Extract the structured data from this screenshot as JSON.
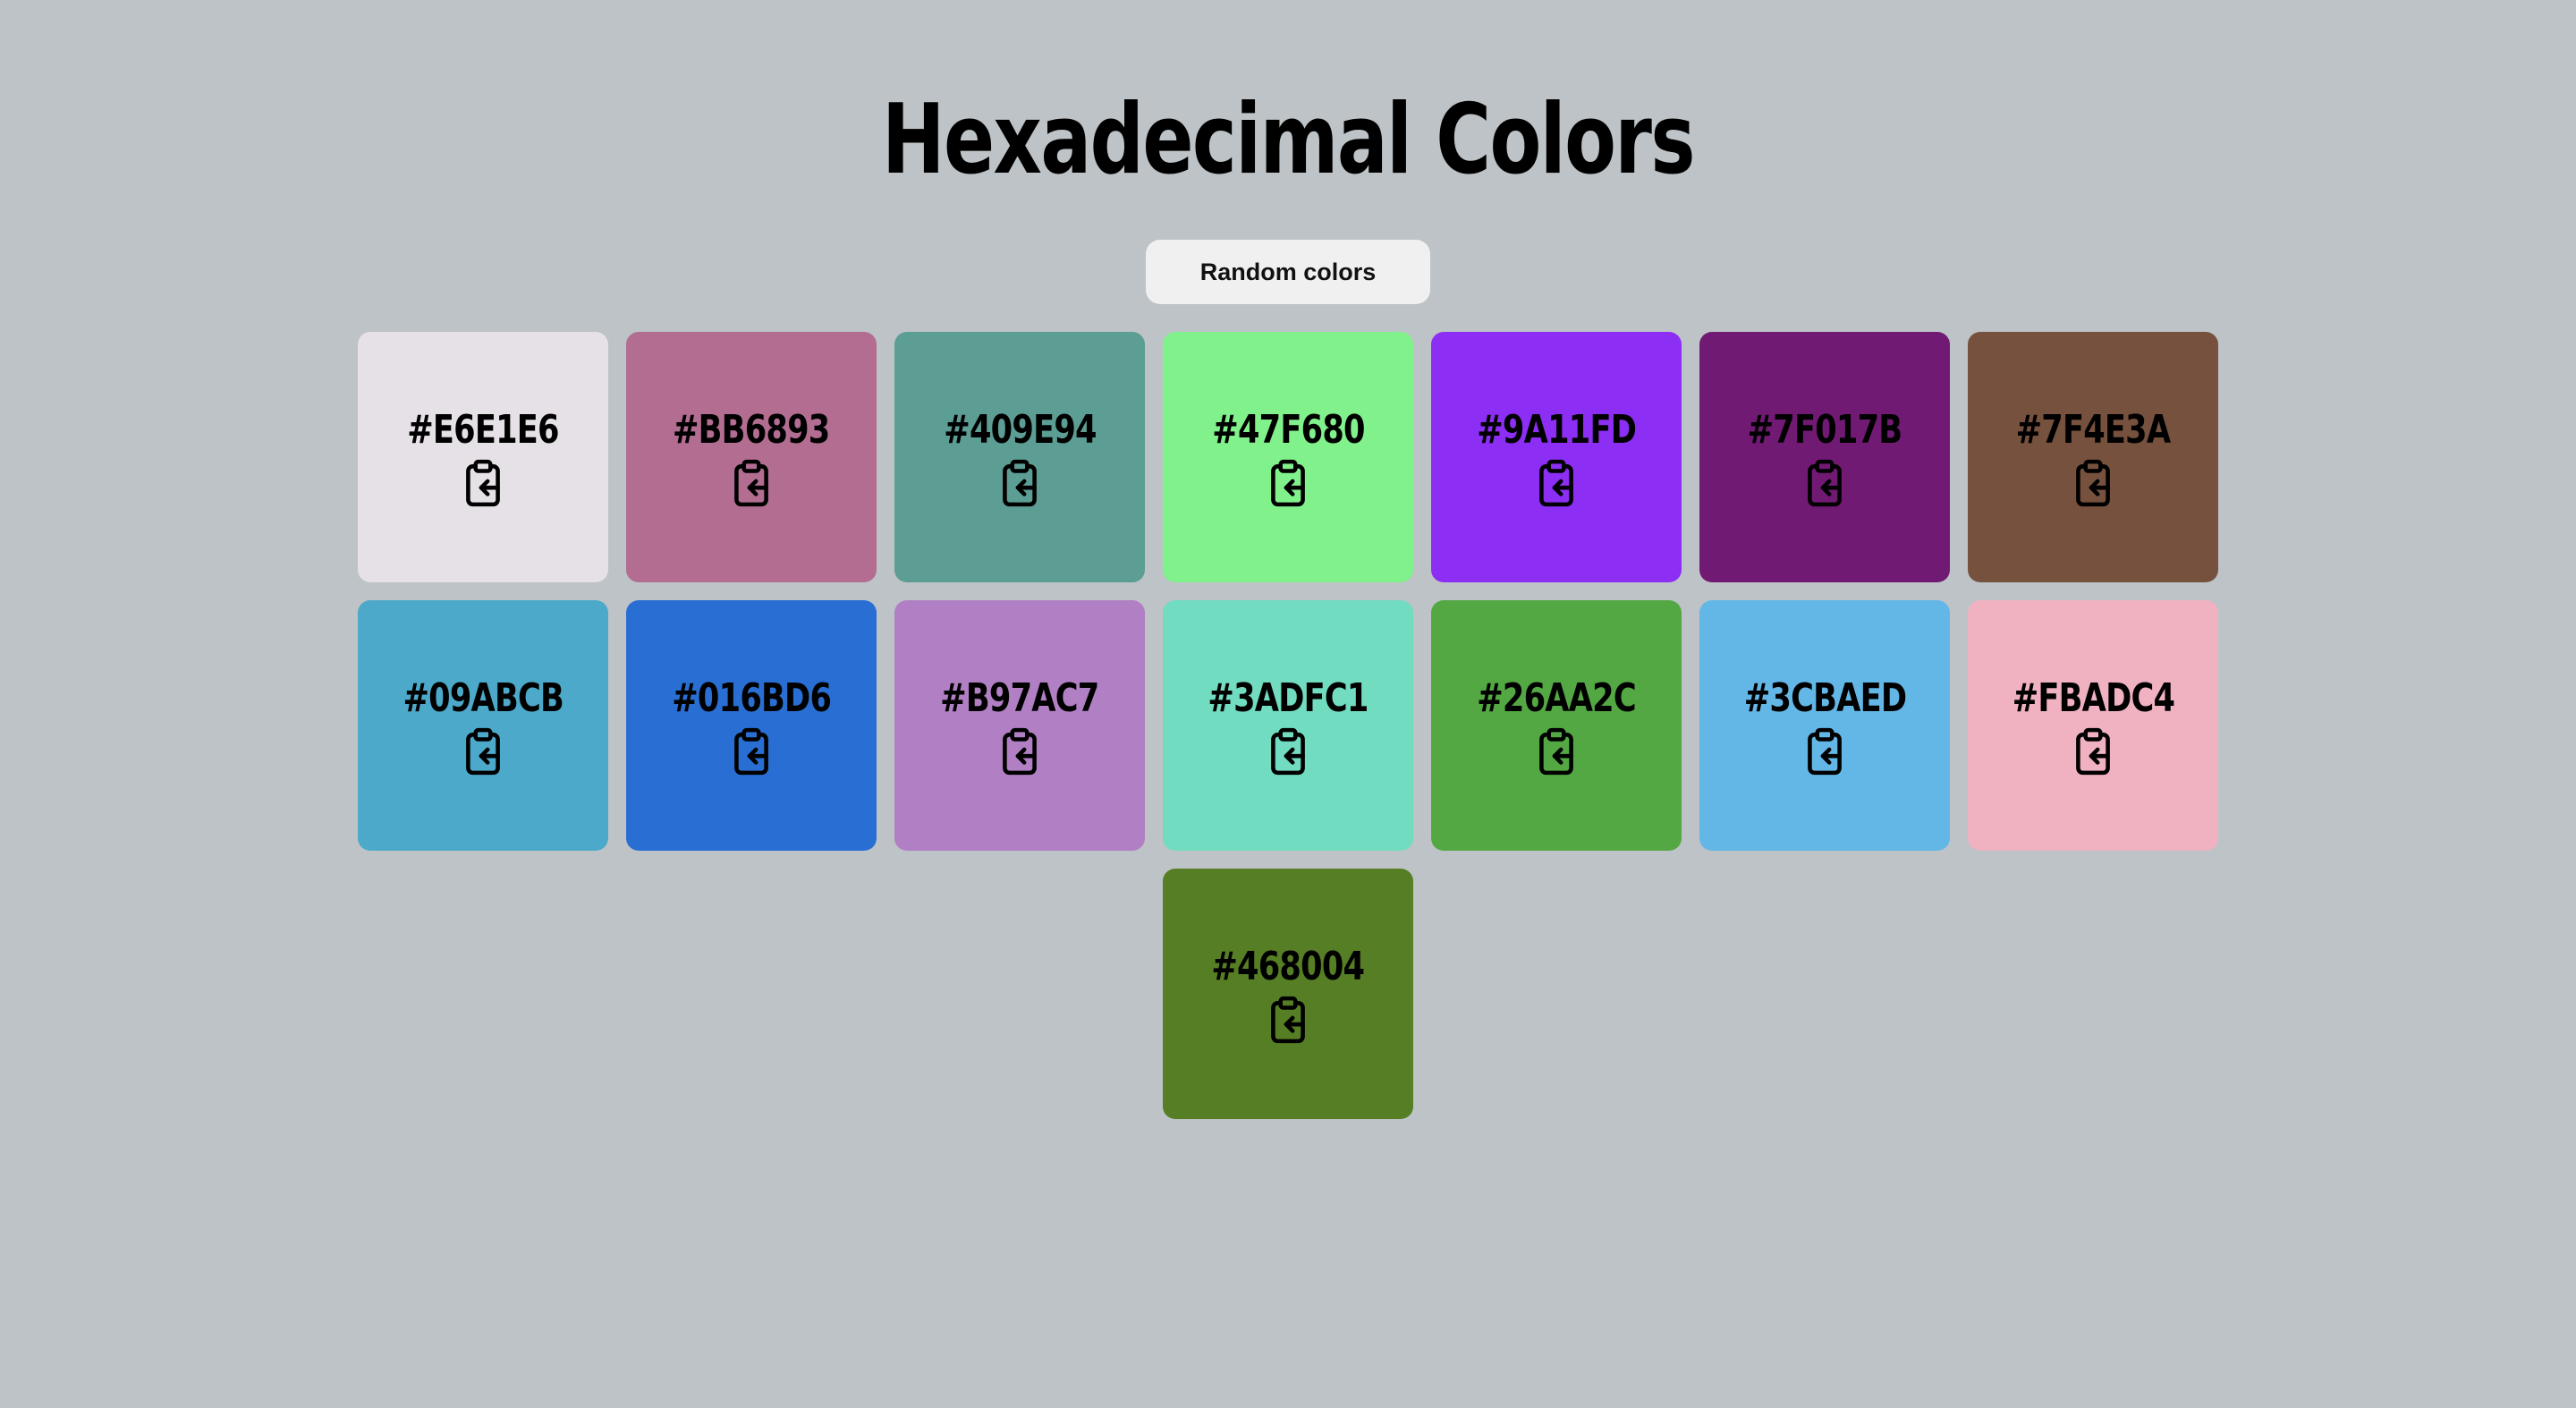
{
  "header": {
    "title": "Hexadecimal Colors"
  },
  "controls": {
    "random_label": "Random colors"
  },
  "swatches": [
    {
      "hex": "#E6E1E6",
      "color": "#E6E1E6"
    },
    {
      "hex": "#BB6893",
      "color": "#B26D91"
    },
    {
      "hex": "#409E94",
      "color": "#5C9D94"
    },
    {
      "hex": "#47F680",
      "color": "#81F18C"
    },
    {
      "hex": "#9A11FD",
      "color": "#8C2EF3"
    },
    {
      "hex": "#7F017B",
      "color": "#711A74"
    },
    {
      "hex": "#7F4E3A",
      "color": "#76513D"
    },
    {
      "hex": "#09ABCB",
      "color": "#4CA9CA"
    },
    {
      "hex": "#016BD6",
      "color": "#296ED2"
    },
    {
      "hex": "#B97AC7",
      "color": "#B17FC4"
    },
    {
      "hex": "#3ADFC1",
      "color": "#71DCC0"
    },
    {
      "hex": "#26AA2C",
      "color": "#53A843"
    },
    {
      "hex": "#3CBAED",
      "color": "#63B7E7"
    },
    {
      "hex": "#FBADC4",
      "color": "#F0B1C1"
    },
    {
      "hex": "#468004",
      "color": "#567E24"
    }
  ],
  "icons": {
    "copy": "clipboard-arrow-left-icon"
  },
  "colors": {
    "background": "#BDC3C6",
    "button_bg": "#F0F0F0",
    "text": "#000000"
  }
}
